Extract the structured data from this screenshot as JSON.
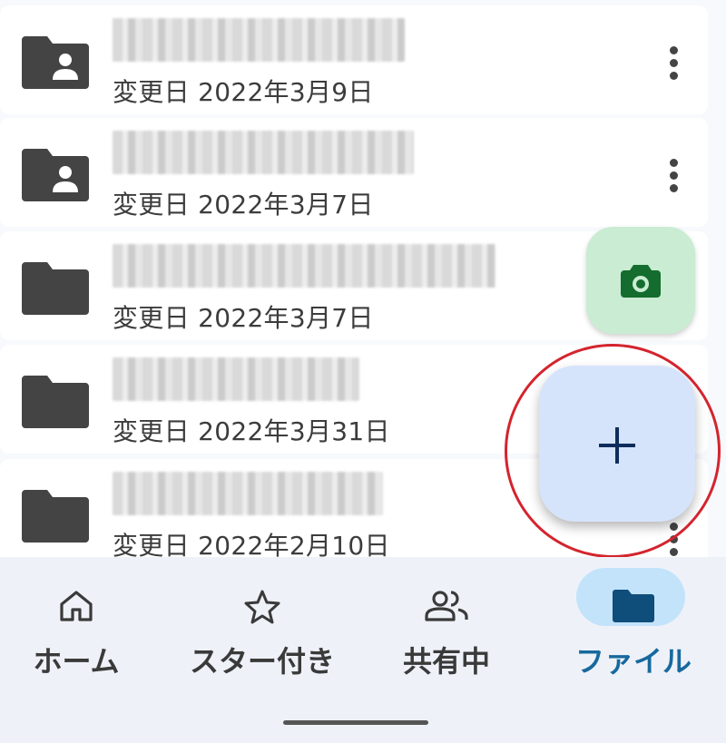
{
  "files": [
    {
      "type": "shared-folder",
      "name": "",
      "modified": "変更日 2022年3月9日"
    },
    {
      "type": "shared-folder",
      "name": "",
      "modified": "変更日 2022年3月7日"
    },
    {
      "type": "folder",
      "name": "",
      "modified": "変更日 2022年3月7日"
    },
    {
      "type": "folder",
      "name": "",
      "modified": "変更日 2022年3月31日"
    },
    {
      "type": "folder",
      "name": "",
      "modified": "変更日 2022年2月10日"
    }
  ],
  "fab": {
    "camera_icon": "camera-icon",
    "new_icon": "plus-icon"
  },
  "nav": {
    "items": [
      {
        "label": "ホーム",
        "icon": "home-icon",
        "active": false
      },
      {
        "label": "スター付き",
        "icon": "star-icon",
        "active": false
      },
      {
        "label": "共有中",
        "icon": "people-icon",
        "active": false
      },
      {
        "label": "ファイル",
        "icon": "folder-icon",
        "active": true
      }
    ]
  },
  "colors": {
    "accent": "#17699e",
    "fab_new_bg": "#d6e4fb",
    "fab_camera_bg": "#c9ecd2",
    "camera_icon": "#146c2e",
    "highlight_ring": "#d4242e",
    "icon_dark": "#444444"
  }
}
